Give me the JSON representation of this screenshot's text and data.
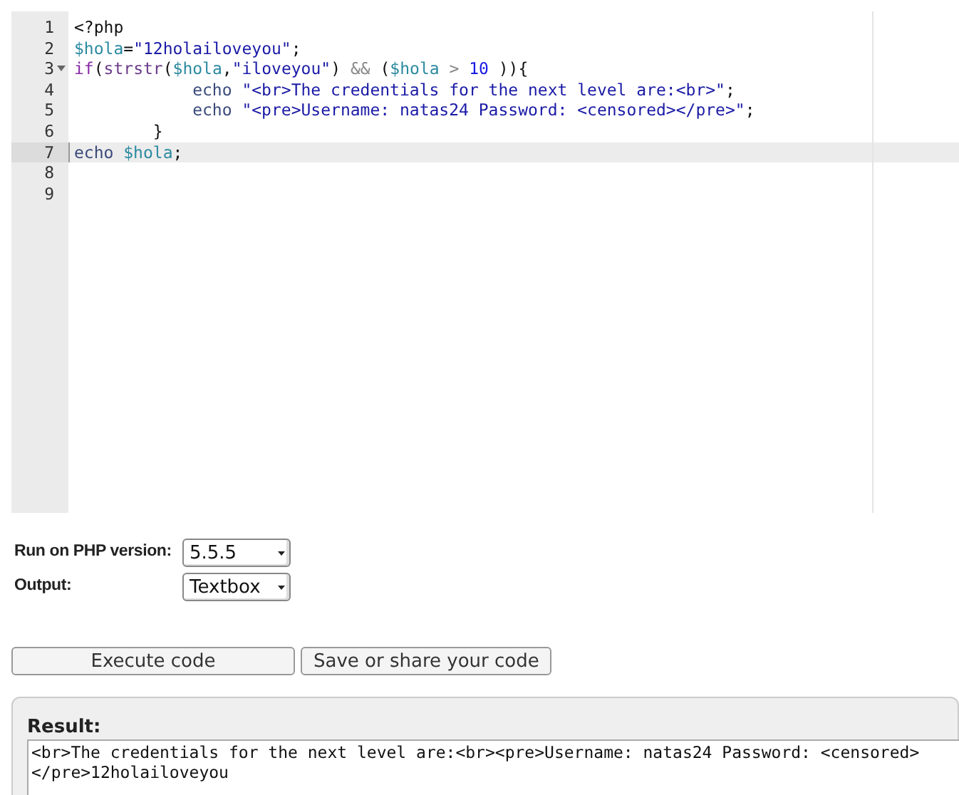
{
  "editor": {
    "lines": [
      {
        "number": "1",
        "fold": false,
        "active": false,
        "kind": "top",
        "tokens": [
          {
            "kind": "plain",
            "text": "<?php"
          }
        ]
      },
      {
        "number": "2",
        "fold": false,
        "active": false,
        "kind": "top",
        "tokens": [
          {
            "kind": "var",
            "text": "$hola"
          },
          {
            "kind": "plain",
            "text": "="
          },
          {
            "kind": "string",
            "text": "\"12holailoveyou\""
          },
          {
            "kind": "plain",
            "text": ";"
          }
        ]
      },
      {
        "number": "3",
        "fold": true,
        "active": false,
        "kind": "top",
        "tokens": [
          {
            "kind": "keyword",
            "text": "if"
          },
          {
            "kind": "plain",
            "text": "("
          },
          {
            "kind": "func",
            "text": "strstr"
          },
          {
            "kind": "plain",
            "text": "("
          },
          {
            "kind": "var",
            "text": "$hola"
          },
          {
            "kind": "plain",
            "text": ","
          },
          {
            "kind": "string",
            "text": "\"iloveyou\""
          },
          {
            "kind": "plain",
            "text": ") "
          },
          {
            "kind": "operator",
            "text": "&&"
          },
          {
            "kind": "plain",
            "text": " ("
          },
          {
            "kind": "var",
            "text": "$hola"
          },
          {
            "kind": "operator",
            "text": " > "
          },
          {
            "kind": "number",
            "text": "10"
          },
          {
            "kind": "plain",
            "text": " )){"
          }
        ]
      },
      {
        "number": "4",
        "fold": false,
        "active": false,
        "kind": "body",
        "tokens": [
          {
            "kind": "echo",
            "text": "echo"
          },
          {
            "kind": "string",
            "text": " \"<br>The credentials for the next level are:<br>\""
          },
          {
            "kind": "plain",
            "text": ";"
          }
        ]
      },
      {
        "number": "5",
        "fold": false,
        "active": false,
        "kind": "body",
        "tokens": [
          {
            "kind": "echo",
            "text": "echo"
          },
          {
            "kind": "string",
            "text": " \"<pre>Username: natas24 Password: <censored></pre>\""
          },
          {
            "kind": "plain",
            "text": ";"
          }
        ]
      },
      {
        "number": "6",
        "fold": false,
        "active": false,
        "kind": "close",
        "tokens": [
          {
            "kind": "plain",
            "text": "}"
          }
        ]
      },
      {
        "number": "7",
        "fold": false,
        "active": true,
        "kind": "top",
        "tokens": [
          {
            "kind": "echo",
            "text": "echo"
          },
          {
            "kind": "var",
            "text": " $hola"
          },
          {
            "kind": "plain",
            "text": ";"
          }
        ]
      },
      {
        "number": "8",
        "fold": false,
        "active": false
      },
      {
        "number": "9",
        "fold": false,
        "active": false
      }
    ]
  },
  "options": [
    {
      "label": "Run on PHP version:",
      "value": "5.5.5"
    },
    {
      "label": "Output:",
      "value": "Textbox"
    }
  ],
  "buttons": [
    "Execute code",
    "Save or share your code"
  ],
  "result": {
    "title": "Result:",
    "text": "<br>The credentials for the next level are:<br><pre>Username: natas24 Password: <censored> </pre>12holailoveyou"
  }
}
